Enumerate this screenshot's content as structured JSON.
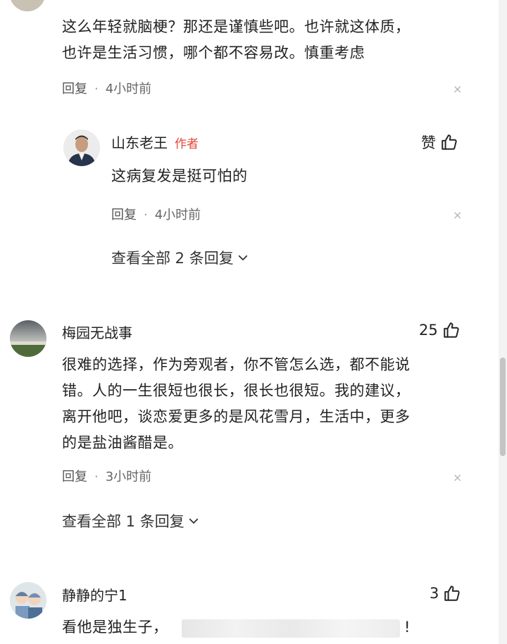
{
  "comment1": {
    "text_line1": "这么年轻就脑梗？那还是谨慎些吧。也许就这体质，",
    "text_line2": "也许是生活习惯，哪个都不容易改。慎重考虑",
    "reply_label": "回复",
    "separator": "·",
    "time": "4小时前",
    "close_glyph": "×"
  },
  "reply1": {
    "name": "山东老王",
    "tag": "作者",
    "like_label": "赞",
    "text": "这病复发是挺可怕的",
    "reply_label": "回复",
    "separator": "·",
    "time": "4小时前",
    "close_glyph": "×",
    "view_all": "查看全部 2 条回复"
  },
  "comment2": {
    "name": "梅园无战事",
    "likes": "25",
    "text_line1": "很难的选择，作为旁观者，你不管怎么选，都不能说",
    "text_line2": "错。人的一生很短也很长，很长也很短。我的建议，",
    "text_line3": "离开他吧，谈恋爱更多的是风花雪月，生活中，更多",
    "text_line4": "的是盐油酱醋是。",
    "reply_label": "回复",
    "separator": "·",
    "time": "3小时前",
    "close_glyph": "×",
    "view_all": "查看全部 1 条回复"
  },
  "comment3": {
    "name": "静静的宁1",
    "likes": "3",
    "text_start": "看他是独生子，",
    "text_end": "!"
  },
  "icons": {
    "like": "thumbs-up-icon",
    "chevron": "chevron-down-icon",
    "close": "close-icon"
  },
  "colors": {
    "author_tag": "#e0463a",
    "text": "#222222",
    "meta": "#666666"
  }
}
